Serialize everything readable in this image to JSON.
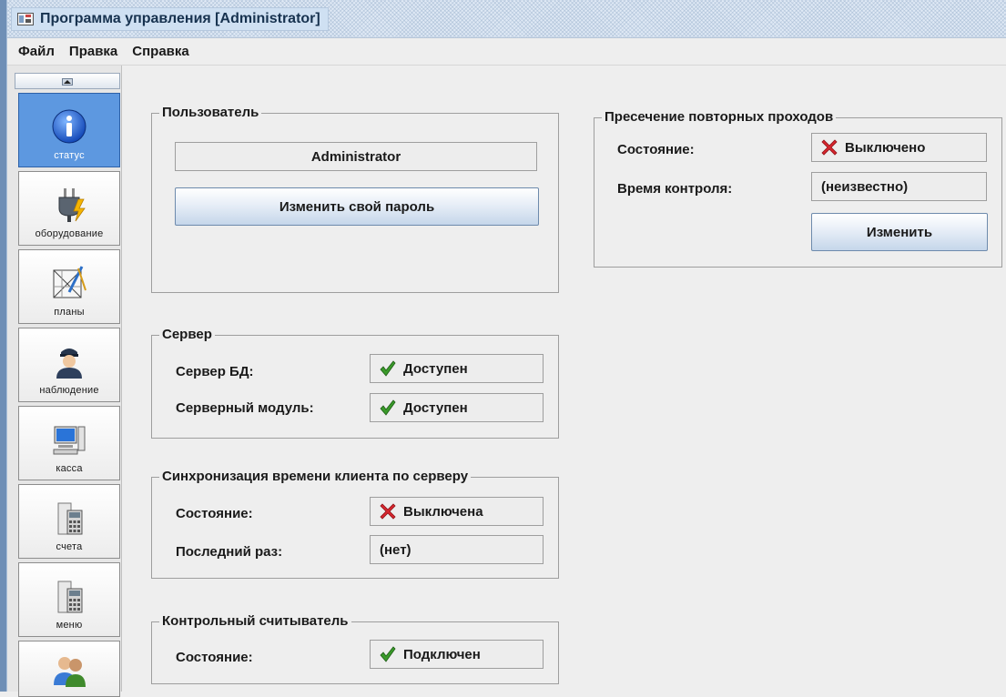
{
  "window": {
    "title": "Программа управления [Administrator]"
  },
  "menu": [
    {
      "label": "Файл"
    },
    {
      "label": "Правка"
    },
    {
      "label": "Справка"
    }
  ],
  "sidebar": {
    "items": [
      {
        "label": "статус",
        "icon": "info-icon",
        "active": true
      },
      {
        "label": "оборудование",
        "icon": "plug-icon"
      },
      {
        "label": "планы",
        "icon": "plans-icon"
      },
      {
        "label": "наблюдение",
        "icon": "guard-icon"
      },
      {
        "label": "касса",
        "icon": "computer-icon"
      },
      {
        "label": "счета",
        "icon": "calculator-icon"
      },
      {
        "label": "меню",
        "icon": "calculator-icon"
      },
      {
        "label": "",
        "icon": "users-icon"
      }
    ]
  },
  "user_group": {
    "title": "Пользователь",
    "username": "Administrator",
    "change_password": "Изменить свой пароль"
  },
  "server_group": {
    "title": "Сервер",
    "db_label": "Сервер БД:",
    "db_status": "Доступен",
    "module_label": "Серверный модуль:",
    "module_status": "Доступен"
  },
  "sync_group": {
    "title": "Синхронизация времени клиента по серверу",
    "state_label": "Состояние:",
    "state_value": "Выключена",
    "last_label": "Последний раз:",
    "last_value": "(нет)"
  },
  "reader_group": {
    "title": "Контрольный считыватель",
    "state_label": "Состояние:",
    "state_value": "Подключен"
  },
  "antipass_group": {
    "title": "Пресечение повторных проходов",
    "state_label": "Состояние:",
    "state_value": "Выключено",
    "time_label": "Время контроля:",
    "time_value": "(неизвестно)",
    "change_button": "Изменить"
  },
  "colors": {
    "ok": "#3a9a2a",
    "error": "#d8262e",
    "active_nav": "#5d98e0"
  }
}
